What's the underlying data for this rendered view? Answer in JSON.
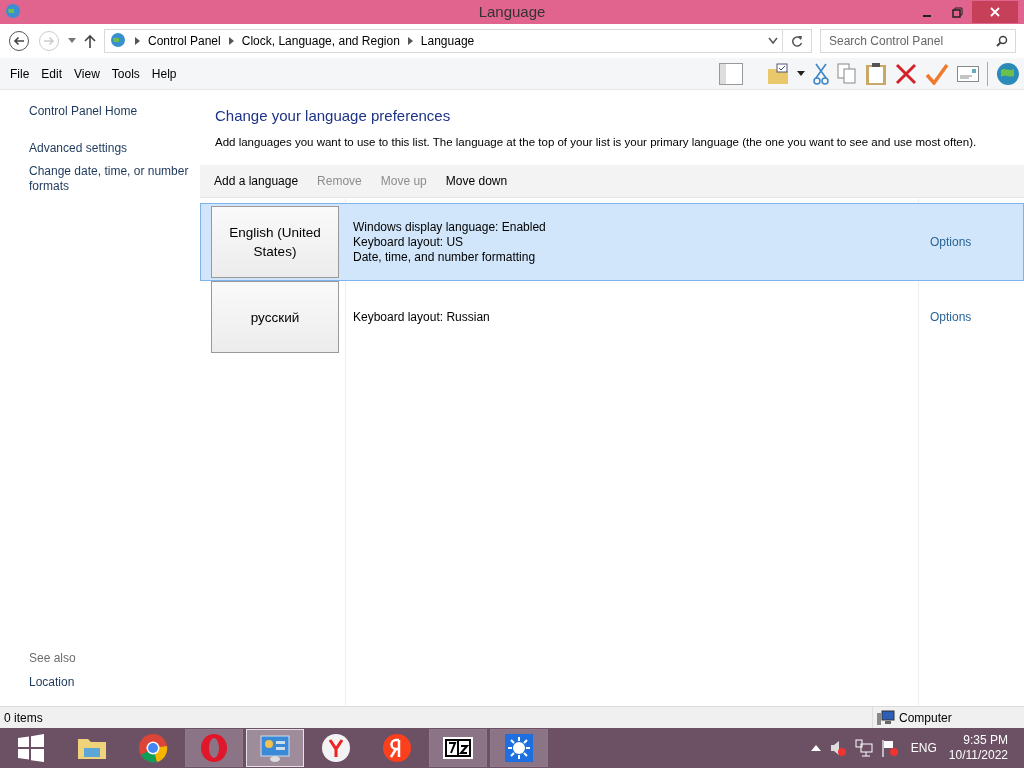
{
  "window": {
    "title": "Language"
  },
  "address": {
    "breadcrumbs": [
      "Control Panel",
      "Clock, Language, and Region",
      "Language"
    ],
    "search": {
      "placeholder": "Search Control Panel"
    }
  },
  "menu": [
    "File",
    "Edit",
    "View",
    "Tools",
    "Help"
  ],
  "sidebar": {
    "links": [
      "Control Panel Home",
      "Advanced settings",
      "Change date, time, or number formats"
    ],
    "see_also": {
      "heading": "See also",
      "links": [
        "Location"
      ]
    }
  },
  "content": {
    "heading": "Change your language preferences",
    "description": "Add languages you want to use to this list. The language at the top of your list is your primary language (the one you want to see and use most often).",
    "actions": [
      {
        "label": "Add a language",
        "disabled": false
      },
      {
        "label": "Remove",
        "disabled": true
      },
      {
        "label": "Move up",
        "disabled": true
      },
      {
        "label": "Move down",
        "disabled": false
      }
    ],
    "languages": [
      {
        "name": "English (United States)",
        "details": [
          "Windows display language: Enabled",
          "Keyboard layout: US",
          "Date, time, and number formatting"
        ],
        "options": "Options",
        "selected": true
      },
      {
        "name": "русский",
        "details": [
          "Keyboard layout: Russian"
        ],
        "options": "Options",
        "selected": false
      }
    ]
  },
  "status_bar": {
    "items": "0 items",
    "location": "Computer"
  },
  "taskbar": {
    "apps": [
      {
        "kind": "files",
        "running": false,
        "selected": false
      },
      {
        "kind": "chrome",
        "running": false,
        "selected": false
      },
      {
        "kind": "opera",
        "running": true,
        "selected": false
      },
      {
        "kind": "panel",
        "running": true,
        "selected": true
      },
      {
        "kind": "yandex-browser",
        "running": false,
        "selected": false
      },
      {
        "kind": "yandex",
        "running": false,
        "selected": false
      },
      {
        "kind": "archiver",
        "running": true,
        "selected": false
      },
      {
        "kind": "sun",
        "running": true,
        "selected": false
      }
    ],
    "language": "ENG",
    "time": "9:35 PM",
    "date": "10/11/2022"
  }
}
